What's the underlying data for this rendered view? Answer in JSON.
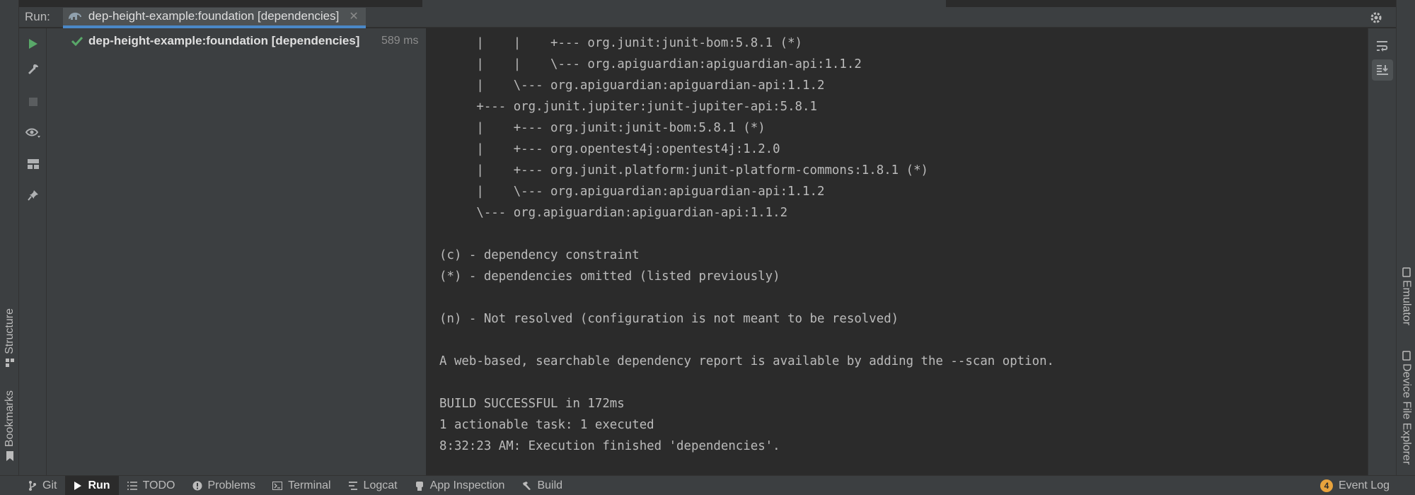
{
  "run_header": {
    "label": "Run:",
    "tab_title": "dep-height-example:foundation [dependencies]"
  },
  "left_strip": {
    "structure": "Structure",
    "bookmarks": "Bookmarks"
  },
  "tree": {
    "item_label": "dep-height-example:foundation [dependencies]",
    "item_time": "589 ms"
  },
  "console": {
    "lines": [
      "     |    |    +--- org.junit:junit-bom:5.8.1 (*)",
      "     |    |    \\--- org.apiguardian:apiguardian-api:1.1.2",
      "     |    \\--- org.apiguardian:apiguardian-api:1.1.2",
      "     +--- org.junit.jupiter:junit-jupiter-api:5.8.1",
      "     |    +--- org.junit:junit-bom:5.8.1 (*)",
      "     |    +--- org.opentest4j:opentest4j:1.2.0",
      "     |    +--- org.junit.platform:junit-platform-commons:1.8.1 (*)",
      "     |    \\--- org.apiguardian:apiguardian-api:1.1.2",
      "     \\--- org.apiguardian:apiguardian-api:1.1.2",
      "",
      "(c) - dependency constraint",
      "(*) - dependencies omitted (listed previously)",
      "",
      "(n) - Not resolved (configuration is not meant to be resolved)",
      "",
      "A web-based, searchable dependency report is available by adding the --scan option.",
      "",
      "BUILD SUCCESSFUL in 172ms",
      "1 actionable task: 1 executed",
      "8:32:23 AM: Execution finished 'dependencies'."
    ]
  },
  "right_strip": {
    "emulator": "Emulator",
    "device_file_explorer": "Device File Explorer"
  },
  "bottom_bar": {
    "git": "Git",
    "run": "Run",
    "todo": "TODO",
    "problems": "Problems",
    "terminal": "Terminal",
    "logcat": "Logcat",
    "app_inspection": "App Inspection",
    "build": "Build",
    "event_log": "Event Log",
    "event_count": "4"
  },
  "colors": {
    "accent": "#4a88c7",
    "success": "#59a869",
    "background": "#2b2b2b",
    "panel": "#3c3f41"
  }
}
